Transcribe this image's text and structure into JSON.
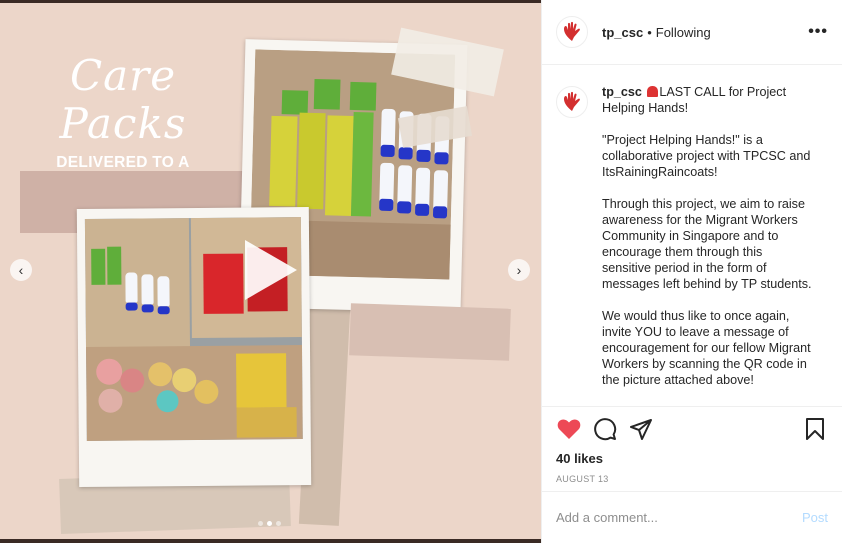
{
  "post": {
    "username": "tp_csc",
    "follow_separator": "•",
    "follow_status": "Following",
    "more_label": "•••"
  },
  "media": {
    "title_script": "Care Packs",
    "subtitle": "DELIVERED TO A FOREIGN WORKERS DORMITORY IN SINGAPORE",
    "prev_label": "‹",
    "next_label": "›",
    "slide_count": 3,
    "active_slide": 2
  },
  "caption": {
    "username": "tp_csc",
    "line1": "LAST CALL for Project Helping Hands!",
    "para2": "\"Project Helping Hands!\" is a collaborative project with TPCSC and ItsRainingRaincoats!",
    "para3": "Through this project, we aim to raise awareness for the Migrant Workers Community in Singapore and to encourage them through this sensitive period in the form of messages left behind by TP students.",
    "para4": "We would thus like to once again, invite YOU to leave a message of encouragement for our fellow Migrant Workers by scanning the QR code in the picture attached above!"
  },
  "engagement": {
    "likes": "40 likes",
    "date": "AUGUST 13",
    "liked": true
  },
  "comment": {
    "placeholder": "Add a comment...",
    "post_label": "Post"
  },
  "colors": {
    "media_background": "#ecd6c9",
    "like_red": "#ed4956",
    "post_disabled": "#b3dbff",
    "brand_red": "#d32f2f"
  },
  "icons": [
    "tp-csc-logo-icon",
    "more-icon",
    "heart-icon",
    "comment-icon",
    "share-icon",
    "bookmark-icon",
    "play-icon",
    "chevron-left-icon",
    "chevron-right-icon",
    "siren-icon"
  ]
}
